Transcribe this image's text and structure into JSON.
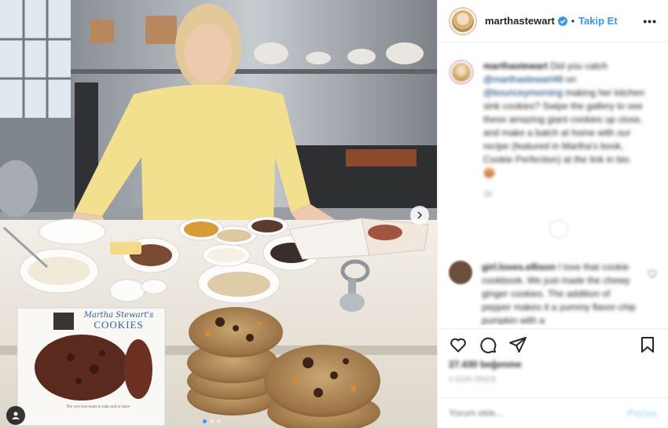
{
  "post": {
    "image_alt": "Kitchen with cookies",
    "book": {
      "title_script": "Martha Stewart's",
      "title_caps": "COOKIES",
      "subtitle": "The very best treats to bake and to share"
    },
    "carousel": {
      "slides": 3,
      "active": 0
    }
  },
  "header": {
    "username": "marthastewart",
    "separator": "•",
    "follow_label": "Takip Et",
    "more_label": "•••"
  },
  "caption": {
    "username": "marthastewart",
    "text_1": " Did you catch ",
    "mention_1": "@marthastewart48",
    "text_2": " on ",
    "mention_2": "@bounceymorning",
    "text_3": " making her kitchen sink cookies? Swipe the gallery to see these amazing giant cookies up close, and make a batch at home with our recipe (featured in Martha's book, Cookie Perfection) at the link in bio. 🍪",
    "time": "1h"
  },
  "comment": {
    "username": "girl.loves.ellison",
    "text": " I love that cookie cookbook. We just made the chewy ginger cookies. The addition of pepper makes it a yummy flavor-chip pumpkin with a"
  },
  "stats": {
    "likes": "27.430 beğenme",
    "date": "4 GÜN ÖNCE"
  },
  "comment_form": {
    "placeholder": "Yorum ekle...",
    "post_label": "Paylaş"
  },
  "colors": {
    "accent": "#3897f0",
    "text": "#262626",
    "muted": "#8e8e8e"
  }
}
